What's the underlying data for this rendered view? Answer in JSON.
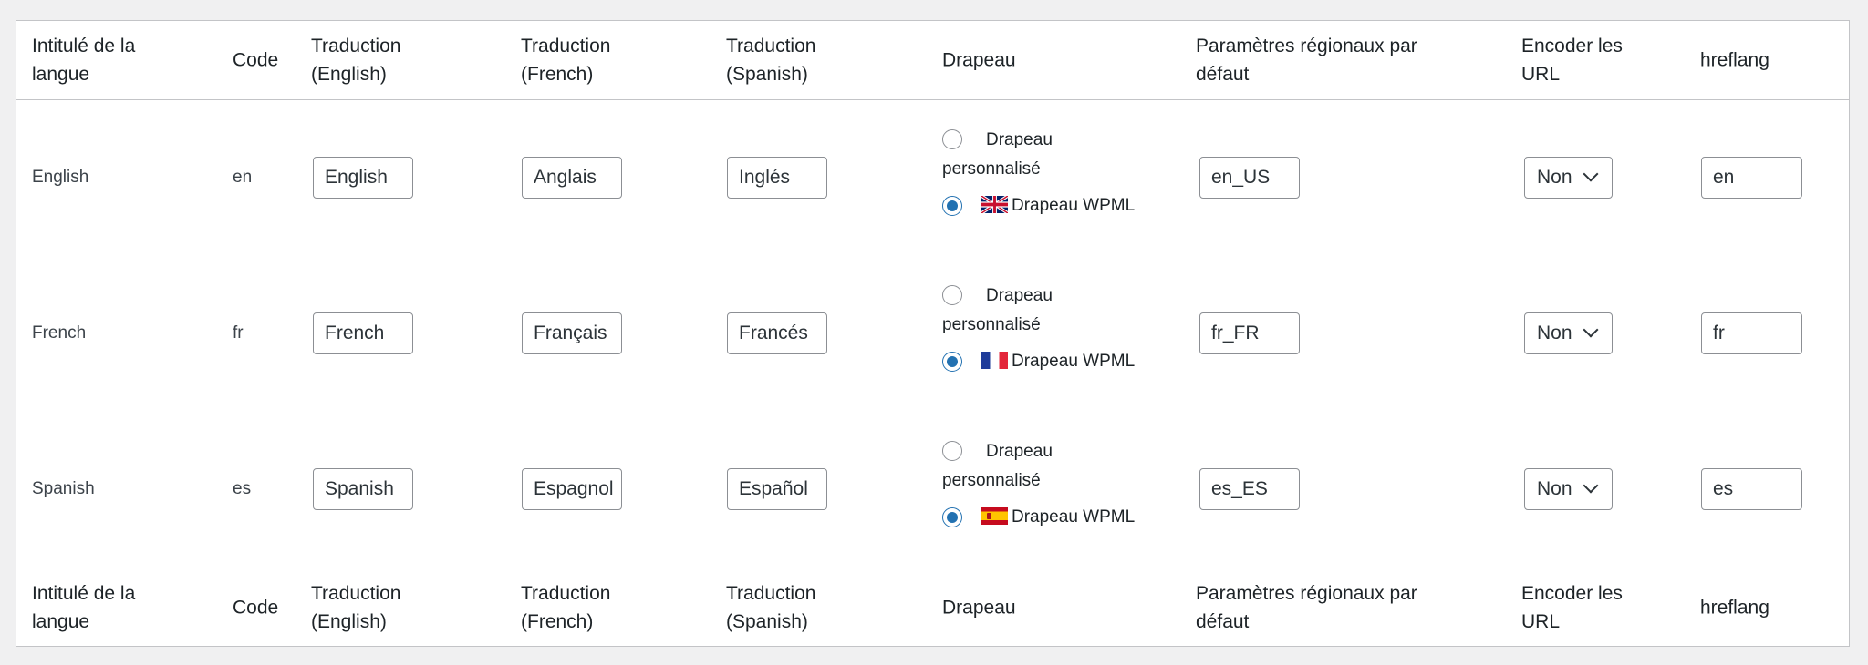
{
  "headers": {
    "language_name": "Intitulé de la langue",
    "code": "Code",
    "trans_en": "Traduction (English)",
    "trans_fr": "Traduction (French)",
    "trans_es": "Traduction (Spanish)",
    "flag": "Drapeau",
    "locale": "Paramètres régionaux par défaut",
    "encode": "Encoder les URL",
    "hreflang": "hreflang"
  },
  "flag_options": {
    "custom": "Drapeau personnalisé",
    "wpml": "Drapeau WPML"
  },
  "rows": [
    {
      "name": "English",
      "code": "en",
      "trans_en": "English",
      "trans_fr": "Anglais",
      "trans_es": "Inglés",
      "flag_choice": "wpml",
      "flag_icon": "uk-flag-icon",
      "locale": "en_US",
      "encode": "Non",
      "hreflang": "en"
    },
    {
      "name": "French",
      "code": "fr",
      "trans_en": "French",
      "trans_fr": "Français",
      "trans_es": "Francés",
      "flag_choice": "wpml",
      "flag_icon": "france-flag-icon",
      "locale": "fr_FR",
      "encode": "Non",
      "hreflang": "fr"
    },
    {
      "name": "Spanish",
      "code": "es",
      "trans_en": "Spanish",
      "trans_fr": "Espagnol",
      "trans_es": "Español",
      "flag_choice": "wpml",
      "flag_icon": "spain-flag-icon",
      "locale": "es_ES",
      "encode": "Non",
      "hreflang": "es"
    }
  ],
  "colors": {
    "accent": "#2271b1",
    "border": "#c3c4c7",
    "input_border": "#8c8f94",
    "page_bg": "#f0f0f1"
  }
}
